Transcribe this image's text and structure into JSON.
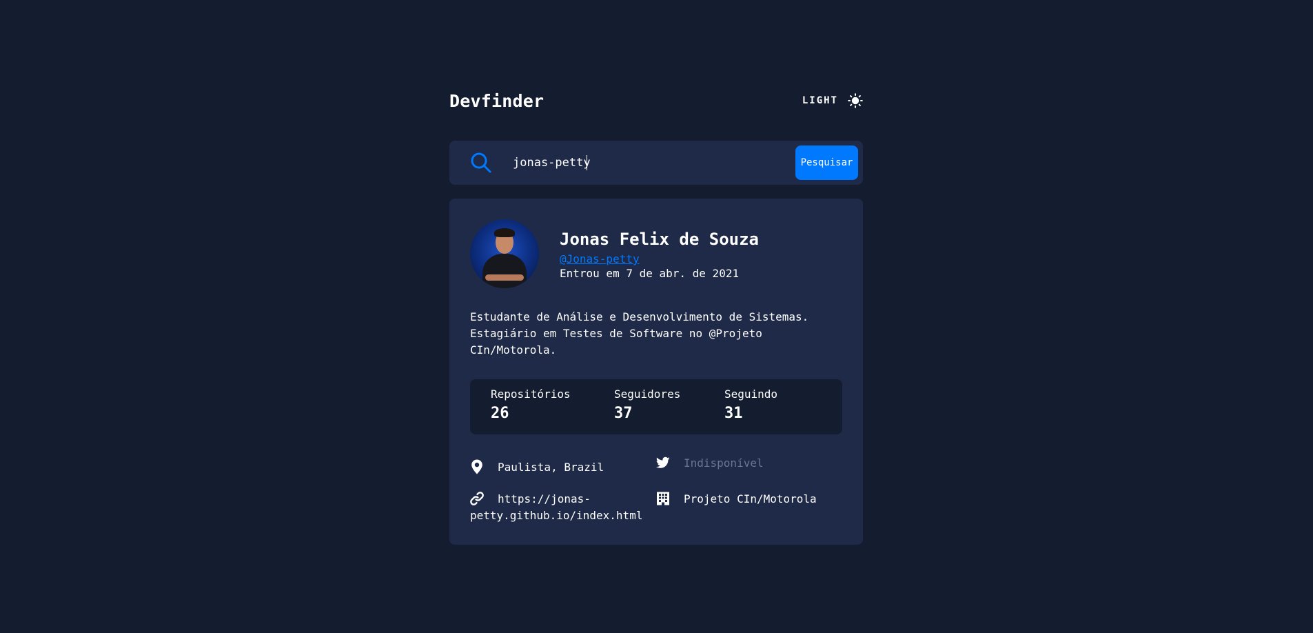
{
  "header": {
    "logo": "Devfinder",
    "theme_label": "LIGHT",
    "theme_icon": "sun-icon"
  },
  "search": {
    "value": "jonas-petty",
    "placeholder": "",
    "button_label": "Pesquisar",
    "icon": "search-icon"
  },
  "profile": {
    "name": "Jonas Felix de Souza",
    "login": "@Jonas-petty",
    "joined": "Entrou em 7 de abr. de 2021",
    "bio": "Estudante de Análise e Desenvolvimento de Sistemas.\nEstagiário em Testes de Software no @Projeto\nCIn/Motorola."
  },
  "stats": {
    "repos_label": "Repositórios",
    "repos_value": "26",
    "followers_label": "Seguidores",
    "followers_value": "37",
    "following_label": "Seguindo",
    "following_value": "31"
  },
  "links": {
    "location": "Paulista, Brazil",
    "twitter": "Indisponível",
    "blog": "https://jonas-petty.github.io/index.html",
    "company": "Projeto CIn/Motorola"
  },
  "colors": {
    "background": "#141d2f",
    "card": "#1e2a47",
    "accent": "#0079ff",
    "muted": "#6a7691",
    "text": "#ffffff"
  }
}
